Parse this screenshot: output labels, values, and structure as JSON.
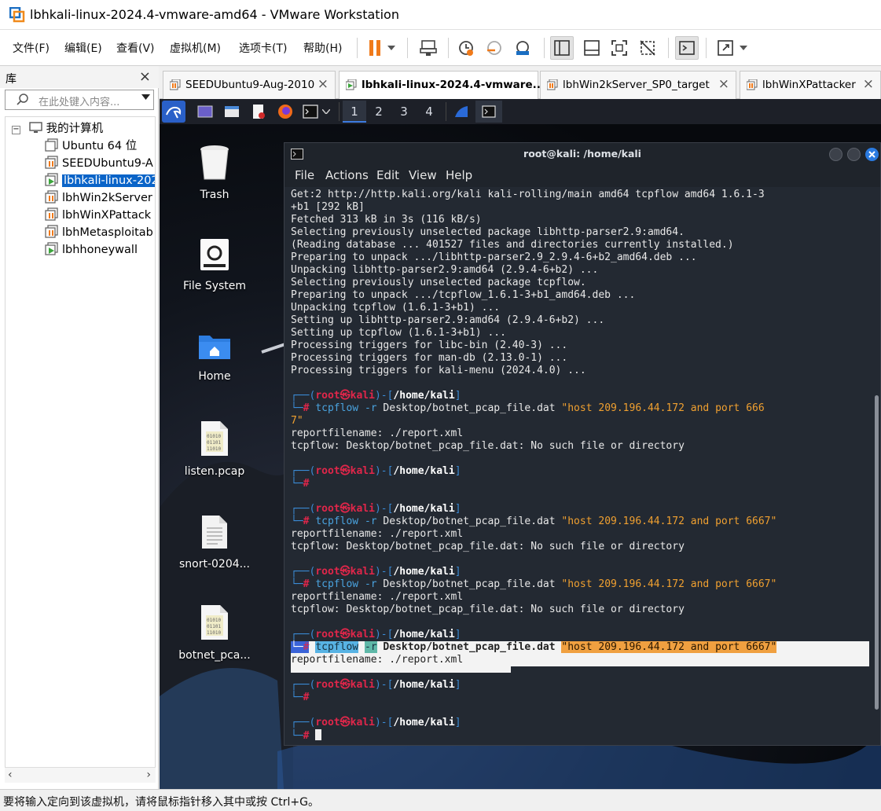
{
  "window": {
    "title": "lbhkali-linux-2024.4-vmware-amd64 - VMware Workstation"
  },
  "menu": {
    "items": [
      "文件(F)",
      "编辑(E)",
      "查看(V)",
      "虚拟机(M)",
      "选项卡(T)",
      "帮助(H)"
    ]
  },
  "toolbar": {
    "icons": [
      "pause-icon",
      "dropdown-icon",
      "send-ctrl-alt-del-icon",
      "snapshot-icon",
      "revert-snapshot-icon",
      "snapshot-manager-icon",
      "show-library-icon",
      "thumbnail-bar-icon",
      "full-screen-icon",
      "unity-icon",
      "console-view-icon",
      "stretch-icon"
    ]
  },
  "library": {
    "title": "库",
    "search_placeholder": "在此处键入内容...",
    "root": "我的计算机",
    "items": [
      {
        "label": "Ubuntu 64 位",
        "state": "off"
      },
      {
        "label": "SEEDUbuntu9-A",
        "state": "suspended"
      },
      {
        "label": "lbhkali-linux-202",
        "state": "running",
        "selected": true
      },
      {
        "label": "lbhWin2kServer",
        "state": "suspended"
      },
      {
        "label": "lbhWinXPattack",
        "state": "suspended"
      },
      {
        "label": "lbhMetasploitab",
        "state": "suspended"
      },
      {
        "label": "lbhhoneywall",
        "state": "running"
      }
    ]
  },
  "tabs": [
    {
      "label": "SEEDUbuntu9-Aug-2010",
      "active": false
    },
    {
      "label": "lbhkali-linux-2024.4-vmware...",
      "active": true
    },
    {
      "label": "lbhWin2kServer_SP0_target",
      "active": false
    },
    {
      "label": "lbhWinXPattacker",
      "active": false
    }
  ],
  "kali_panel": {
    "workspaces": [
      "1",
      "2",
      "3",
      "4"
    ],
    "active_workspace": "1"
  },
  "desktop_icons": [
    {
      "label": "Trash",
      "icon": "trash-icon"
    },
    {
      "label": "File System",
      "icon": "drive-icon"
    },
    {
      "label": "Home",
      "icon": "home-folder-icon"
    },
    {
      "label": "listen.pcap",
      "icon": "binary-file-icon"
    },
    {
      "label": "snort-0204...",
      "icon": "text-file-icon"
    },
    {
      "label": "botnet_pca...",
      "icon": "binary-file-icon"
    }
  ],
  "terminal": {
    "title": "root@kali: /home/kali",
    "menu": [
      "File",
      "Actions",
      "Edit",
      "View",
      "Help"
    ],
    "output_lines": [
      "Get:2 http://http.kali.org/kali kali-rolling/main amd64 tcpflow amd64 1.6.1-3",
      "+b1 [292 kB]",
      "Fetched 313 kB in 3s (116 kB/s)",
      "Selecting previously unselected package libhttp-parser2.9:amd64.",
      "(Reading database ... 401527 files and directories currently installed.)",
      "Preparing to unpack .../libhttp-parser2.9_2.9.4-6+b2_amd64.deb ...",
      "Unpacking libhttp-parser2.9:amd64 (2.9.4-6+b2) ...",
      "Selecting previously unselected package tcpflow.",
      "Preparing to unpack .../tcpflow_1.6.1-3+b1_amd64.deb ...",
      "Unpacking tcpflow (1.6.1-3+b1) ...",
      "Setting up libhttp-parser2.9:amd64 (2.9.4-6+b2) ...",
      "Setting up tcpflow (1.6.1-3+b1) ...",
      "Processing triggers for libc-bin (2.40-3) ...",
      "Processing triggers for man-db (2.13.0-1) ...",
      "Processing triggers for kali-menu (2024.4.0) ..."
    ],
    "prompt": {
      "open": "┌──(",
      "user": "root㉿kali",
      "mid": ")-[",
      "path": "/home/kali",
      "close": "]",
      "second": "└─",
      "hash": "#"
    },
    "cmd_name": "tcpflow",
    "cmd_opt": "-r",
    "cmd_file": "Desktop/botnet_pcap_file.dat",
    "cmd_filter_wrapped_a": "\"host 209.196.44.172 and port 666",
    "cmd_filter_wrapped_b": "7\"",
    "cmd_filter": "\"host 209.196.44.172 and port 6667\"",
    "report_line": "reportfilename: ./report.xml",
    "error_line": "tcpflow: Desktop/botnet_pcap_file.dat: No such file or directory"
  },
  "status": {
    "text": "要将输入定向到该虚拟机，请将鼠标指针移入其中或按 Ctrl+G。"
  }
}
